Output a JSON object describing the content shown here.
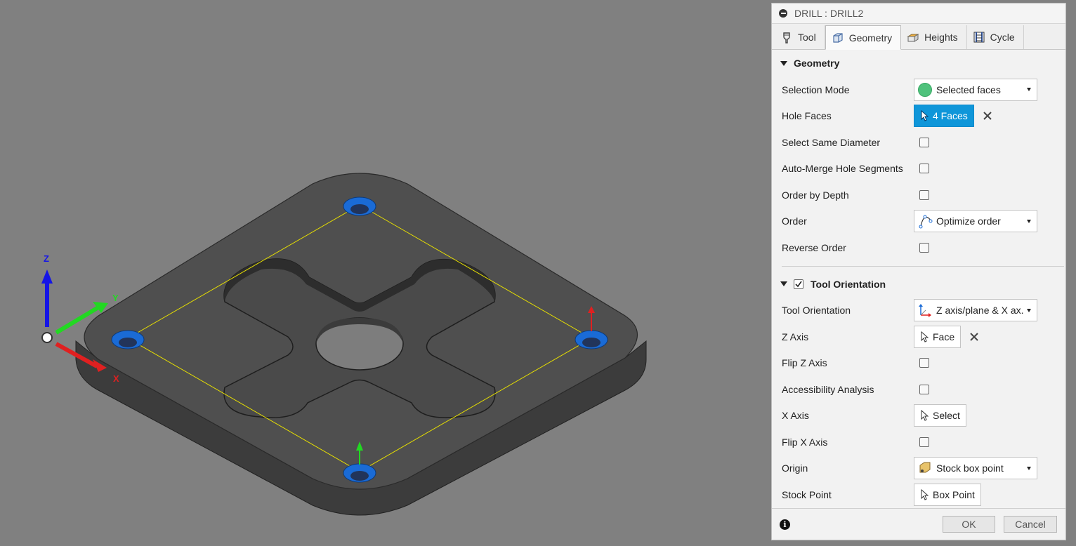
{
  "panel": {
    "title": "DRILL : DRILL2",
    "tabs": [
      {
        "label": "Tool",
        "icon": "tool-icon"
      },
      {
        "label": "Geometry",
        "icon": "geometry-icon",
        "active": true
      },
      {
        "label": "Heights",
        "icon": "heights-icon"
      },
      {
        "label": "Cycle",
        "icon": "cycle-icon"
      }
    ],
    "geometry_section": {
      "title": "Geometry",
      "selection_mode": {
        "label": "Selection Mode",
        "value": "Selected faces"
      },
      "hole_faces": {
        "label": "Hole Faces",
        "value": "4 Faces"
      },
      "select_same_diameter": {
        "label": "Select Same Diameter",
        "checked": false
      },
      "auto_merge": {
        "label": "Auto-Merge Hole Segments",
        "checked": false
      },
      "order_by_depth": {
        "label": "Order by Depth",
        "checked": false
      },
      "order": {
        "label": "Order",
        "value": "Optimize order"
      },
      "reverse_order": {
        "label": "Reverse Order",
        "checked": false
      }
    },
    "tool_orientation_section": {
      "title": "Tool Orientation",
      "enabled": true,
      "tool_orientation": {
        "label": "Tool Orientation",
        "value": "Z axis/plane & X ax..."
      },
      "z_axis": {
        "label": "Z Axis",
        "value": "Face"
      },
      "flip_z_axis": {
        "label": "Flip Z Axis",
        "checked": false
      },
      "accessibility_analysis": {
        "label": "Accessibility Analysis",
        "checked": false
      },
      "x_axis": {
        "label": "X Axis",
        "value": "Select"
      },
      "flip_x_axis": {
        "label": "Flip X Axis",
        "checked": false
      },
      "origin": {
        "label": "Origin",
        "value": "Stock box point"
      },
      "stock_point": {
        "label": "Stock Point",
        "value": "Box Point"
      }
    },
    "footer": {
      "ok_label": "OK",
      "cancel_label": "Cancel"
    }
  },
  "viewport": {
    "axis_labels": {
      "x": "X",
      "y": "Y",
      "z": "Z"
    },
    "background_color": "#808080",
    "selection_color": "#1a6bd6",
    "path_color": "#e8e000"
  }
}
